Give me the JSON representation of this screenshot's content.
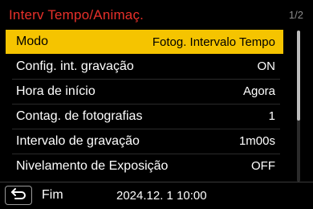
{
  "header": {
    "title": "Interv Tempo/Animaç.",
    "page": "1/2"
  },
  "menu": {
    "items": [
      {
        "label": "Modo",
        "value": "Fotog. Intervalo Tempo"
      },
      {
        "label": "Config. int. gravação",
        "value": "ON"
      },
      {
        "label": "Hora de início",
        "value": "Agora"
      },
      {
        "label": "Contag. de fotografias",
        "value": "1"
      },
      {
        "label": "Intervalo de gravação",
        "value": "1m00s"
      },
      {
        "label": "Nivelamento de Exposição",
        "value": "OFF"
      }
    ]
  },
  "footer": {
    "back_label": "Fim",
    "datetime": "2024.12. 1 10:00"
  },
  "colors": {
    "title": "#e8302a",
    "highlight": "#f5c400"
  }
}
